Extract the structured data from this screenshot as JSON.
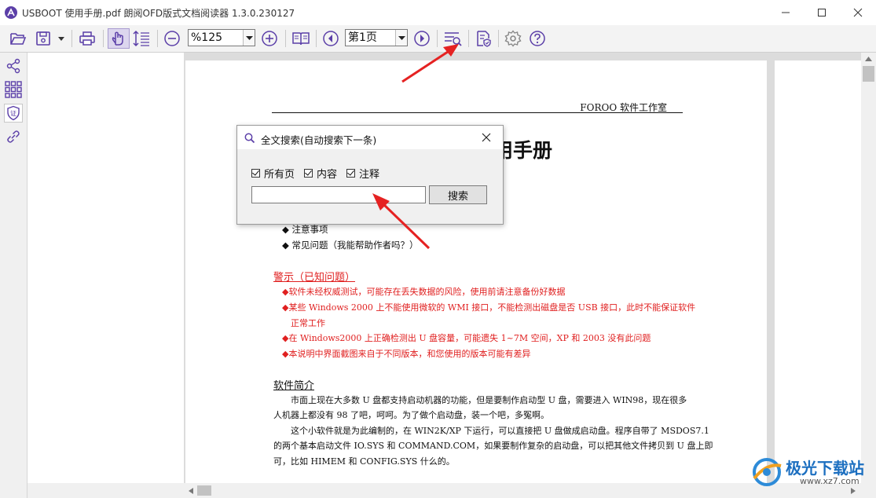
{
  "window": {
    "title": "USBOOT 使用手册.pdf 朗阅OFD版式文档阅读器 1.3.0.230127"
  },
  "toolbar": {
    "zoom_value": "%125",
    "page_value": "第1页"
  },
  "dialog": {
    "title": "全文搜索(自动搜索下一条)",
    "checkboxes": [
      {
        "label": "所有页",
        "checked": true
      },
      {
        "label": "内容",
        "checked": true
      },
      {
        "label": "注释",
        "checked": true
      }
    ],
    "search_value": "",
    "search_button": "搜索"
  },
  "document": {
    "header": "FOROO 软件工作室",
    "title_partial": "用手册",
    "toc": [
      "注意事项",
      "常见问题（我能帮助作者吗？）"
    ],
    "warning_heading": "警示（已知问题）",
    "warnings": [
      "软件未经权威测试，可能存在丢失数据的风险，使用前请注意备份好数据",
      "某些 Windows 2000 上不能使用微软的 WMI 接口，不能检测出磁盘是否 USB 接口，此时不能保证软件",
      "正常工作",
      "在 Windows2000 上正确检测出 U 盘容量，可能遗失 1~7M 空间，XP 和 2003 没有此问题",
      "本说明中界面截图来自于不同版本，和您使用的版本可能有差异"
    ],
    "intro_heading": "软件简介",
    "intro_lines": [
      "市面上现在大多数 U 盘都支持启动机器的功能，但是要制作启动型 U 盘，需要进入 WIN98，现在很多",
      "人机器上都没有 98 了吧，呵呵。为了做个启动盘，装一个吧，多冤啊。",
      "这个小软件就是为此编制的，在 WIN2K/XP 下运行，可以直接把 U 盘做成启动盘。程序自带了 MSDOS7.1",
      "的两个基本启动文件 IO.SYS 和 COMMAND.COM，如果要制作复杂的启动盘，可以把其他文件拷贝到 U 盘上即",
      "可，比如 HIMEM 和 CONFIG.SYS 什么的。"
    ]
  },
  "watermark": {
    "text": "极光下载站",
    "url": "www.xz7.com"
  },
  "colors": {
    "accent": "#5b3fa8",
    "warning_red": "#e02020",
    "annotation_arrow": "#e52222"
  }
}
